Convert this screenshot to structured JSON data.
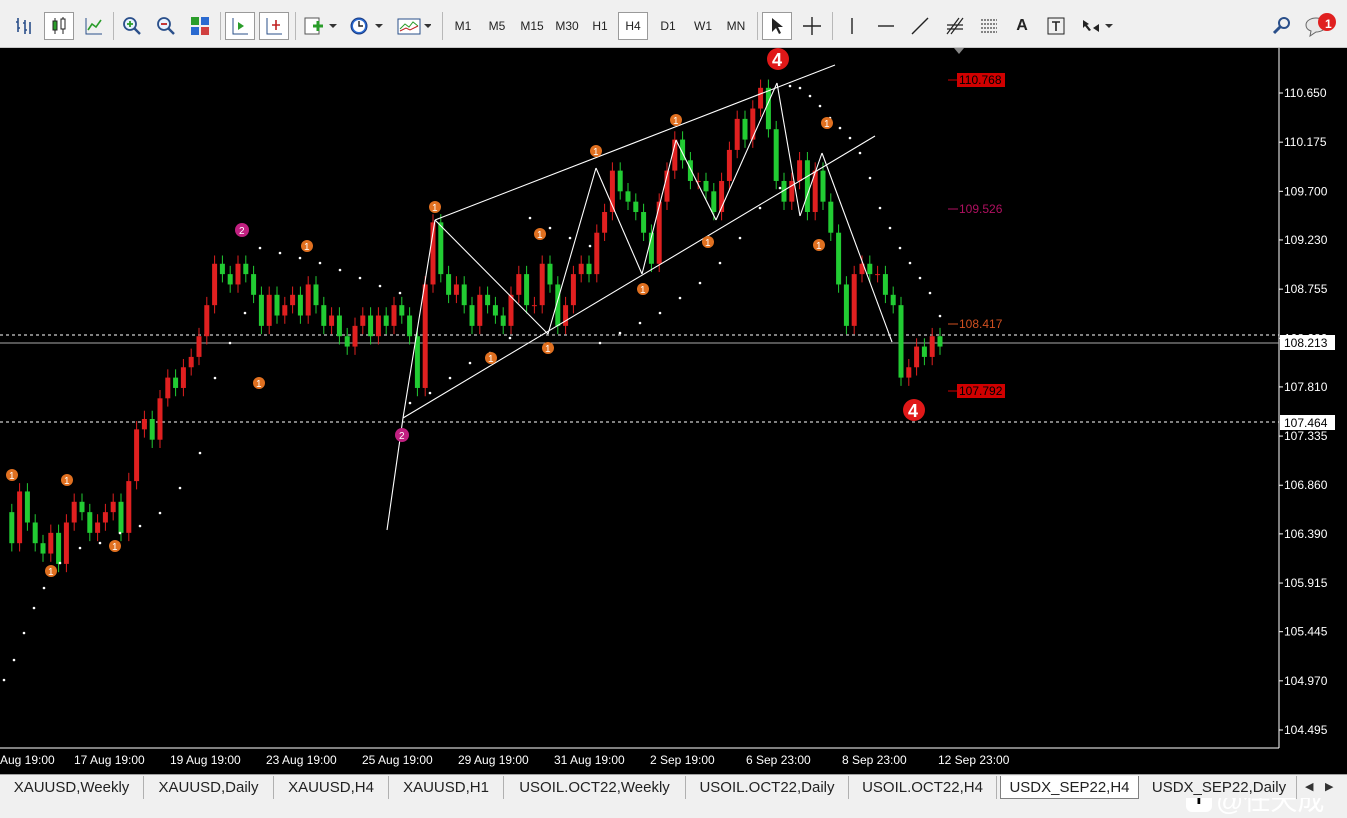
{
  "toolbar": {
    "timeframes": [
      "M1",
      "M5",
      "M15",
      "M30",
      "H1",
      "H4",
      "D1",
      "W1",
      "MN"
    ],
    "active_timeframe": "H4",
    "notification_count": "1"
  },
  "chart": {
    "price_axis": [
      "110.650",
      "110.175",
      "109.700",
      "109.230",
      "108.755",
      "108.280",
      "107.810",
      "107.335",
      "106.860",
      "106.390",
      "105.915",
      "105.445",
      "104.970",
      "104.495"
    ],
    "current_price": "108.213",
    "hline_price": "107.464",
    "time_axis": [
      "Aug 19:00",
      "17 Aug 19:00",
      "19 Aug 19:00",
      "23 Aug 19:00",
      "25 Aug 19:00",
      "29 Aug 19:00",
      "31 Aug 19:00",
      "2 Sep 19:00",
      "6 Sep 23:00",
      "8 Sep 23:00",
      "12 Sep 23:00"
    ],
    "level_labels": [
      {
        "text": "110.768",
        "color": "#d00000",
        "box": true
      },
      {
        "text": "109.526",
        "color": "#b01060",
        "box": false
      },
      {
        "text": "108.417",
        "color": "#d05020",
        "box": false
      },
      {
        "text": "107.792",
        "color": "#d00000",
        "box": true
      }
    ],
    "wave_big_label": "4",
    "wave_labels": [
      "1",
      "2"
    ]
  },
  "tabs": [
    "XAUUSD,Weekly",
    "XAUUSD,Daily",
    "XAUUSD,H4",
    "XAUUSD,H1",
    "USOIL.OCT22,Weekly",
    "USOIL.OCT22,Daily",
    "USOIL.OCT22,H4",
    "USDX_SEP22,H4",
    "USDX_SEP22,Daily"
  ],
  "active_tab": "USDX_SEP22,H4",
  "watermark": "@任天成",
  "icons": [
    "bar-chart-icon",
    "candlestick-icon",
    "line-chart-icon",
    "zoom-in-icon",
    "zoom-out-icon",
    "tile-windows-icon",
    "autoscroll-icon",
    "chart-shift-icon",
    "new-order-icon",
    "clock-icon",
    "template-icon",
    "cursor-icon",
    "crosshair-icon",
    "vertical-line-icon",
    "horizontal-line-icon",
    "trendline-icon",
    "fibonacci-icon",
    "fibo-channel-icon",
    "text-icon",
    "text-label-icon",
    "arrows-icon",
    "search-icon",
    "notification-icon"
  ]
}
